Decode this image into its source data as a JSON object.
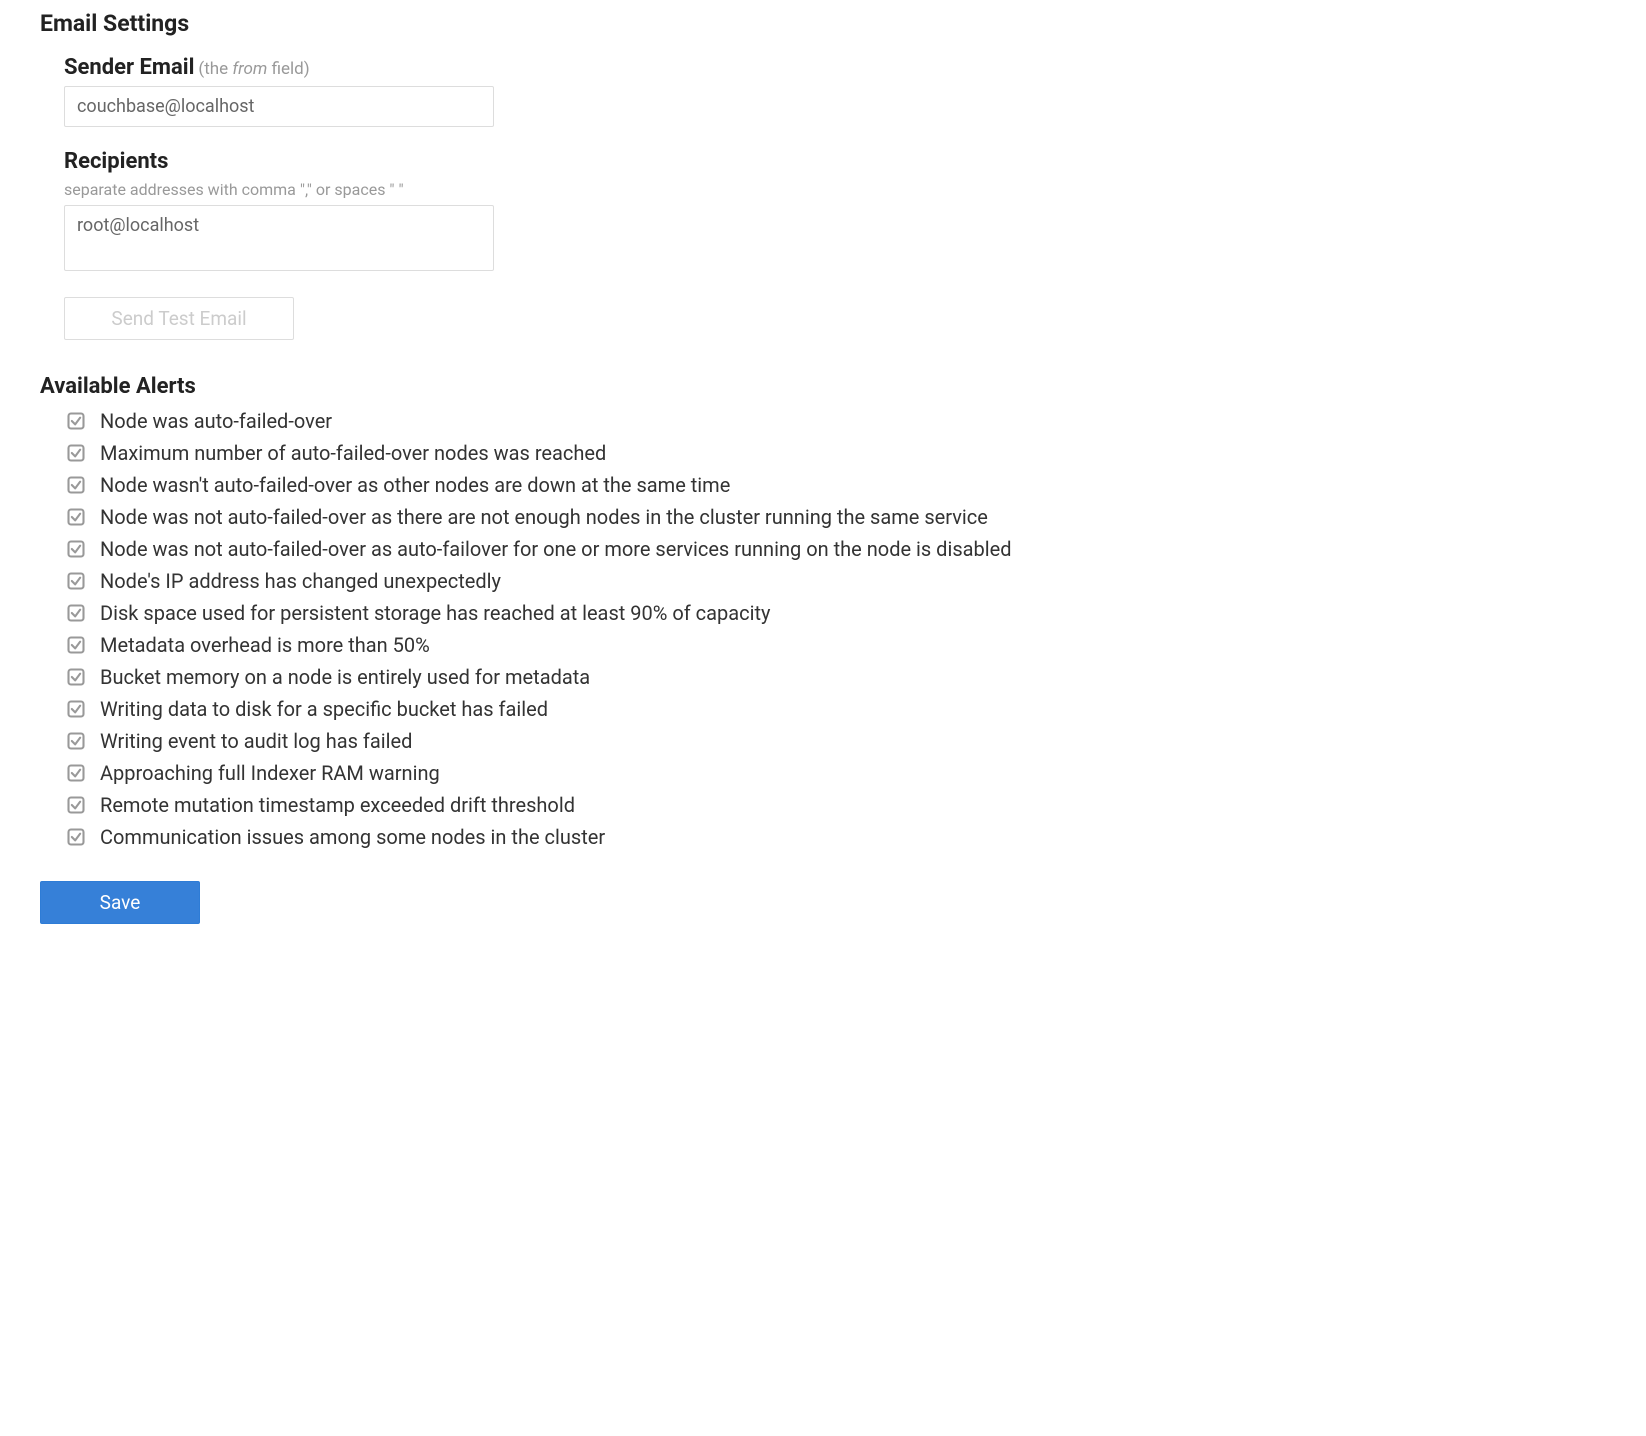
{
  "email_settings": {
    "title": "Email Settings",
    "sender": {
      "label": "Sender Email",
      "hint_prefix": "(the ",
      "hint_italic": "from",
      "hint_suffix": " field)",
      "value": "couchbase@localhost"
    },
    "recipients": {
      "label": "Recipients",
      "hint": "separate addresses with comma \",\" or spaces \" \"",
      "value": "root@localhost"
    },
    "test_button": "Send Test Email"
  },
  "alerts": {
    "title": "Available Alerts",
    "items": [
      {
        "label": "Node was auto-failed-over",
        "checked": true
      },
      {
        "label": "Maximum number of auto-failed-over nodes was reached",
        "checked": true
      },
      {
        "label": "Node wasn't auto-failed-over as other nodes are down at the same time",
        "checked": true
      },
      {
        "label": "Node was not auto-failed-over as there are not enough nodes in the cluster running the same service",
        "checked": true
      },
      {
        "label": "Node was not auto-failed-over as auto-failover for one or more services running on the node is disabled",
        "checked": true
      },
      {
        "label": "Node's IP address has changed unexpectedly",
        "checked": true
      },
      {
        "label": "Disk space used for persistent storage has reached at least 90% of capacity",
        "checked": true
      },
      {
        "label": "Metadata overhead is more than 50%",
        "checked": true
      },
      {
        "label": "Bucket memory on a node is entirely used for metadata",
        "checked": true
      },
      {
        "label": "Writing data to disk for a specific bucket has failed",
        "checked": true
      },
      {
        "label": "Writing event to audit log has failed",
        "checked": true
      },
      {
        "label": "Approaching full Indexer RAM warning",
        "checked": true
      },
      {
        "label": "Remote mutation timestamp exceeded drift threshold",
        "checked": true
      },
      {
        "label": "Communication issues among some nodes in the cluster",
        "checked": true
      }
    ]
  },
  "save_button": "Save"
}
